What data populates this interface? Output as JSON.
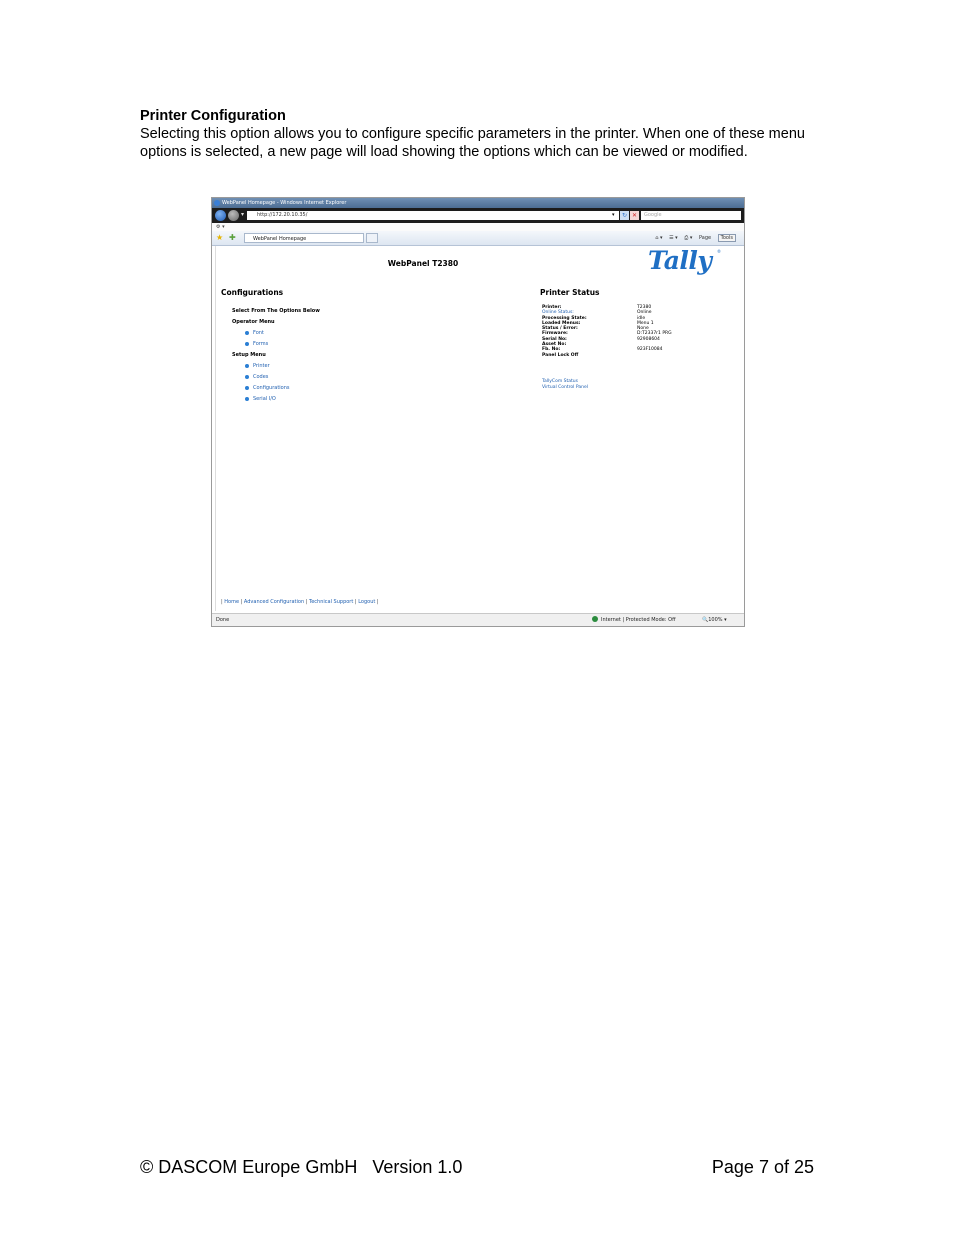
{
  "document": {
    "heading": "Printer Configuration",
    "body": "Selecting this option allows you to configure specific parameters in the printer.  When one of these menu options is selected, a new page will load showing the options which can be viewed or modified."
  },
  "browser": {
    "window_title": "WebPanel Homepage - Windows Internet Explorer",
    "url": "http://172.20.10.35/",
    "search_placeholder": "Google",
    "tab_label": "WebPanel Homepage",
    "tools": [
      "Page",
      "Tools"
    ],
    "status_left": "Done",
    "status_zone": "Internet | Protected Mode: Off",
    "status_zoom": "100%"
  },
  "webpanel": {
    "title": "WebPanel T2380",
    "logo": "Tally",
    "configurations_heading": "Configurations",
    "select_label": "Select From The Options Below",
    "operator_menu_label": "Operator Menu",
    "operator_items": [
      "Font",
      "Forms"
    ],
    "setup_menu_label": "Setup Menu",
    "setup_items": [
      "Printer",
      "Codes",
      "Configurations",
      "Serial I/O"
    ],
    "status_heading": "Printer Status",
    "status_rows": [
      {
        "key": "Printer:",
        "value": "T2380"
      },
      {
        "key": "Online Status:",
        "value": "Online",
        "link": true
      },
      {
        "key": "Processing State:",
        "value": "idle"
      },
      {
        "key": "Loaded Menus:",
        "value": "Menu 1"
      },
      {
        "key": "Status / Error:",
        "value": "None"
      },
      {
        "key": "Firmware:",
        "value": "D:T2337r1 PRG"
      },
      {
        "key": "Serial No:",
        "value": "92908604"
      },
      {
        "key": "Asset No:",
        "value": ""
      },
      {
        "key": "Fb. No:",
        "value": "923F10084"
      },
      {
        "key": "Panel Lock Off",
        "value": ""
      }
    ],
    "status_links": [
      "TallyCom Status",
      "Virtual Control Panel"
    ],
    "footer_links": [
      "Home",
      "Advanced Configuration",
      "Technical Support",
      "Logout"
    ]
  },
  "page_footer": {
    "left": "© DASCOM Europe GmbH   Version 1.0",
    "right": "Page 7 of 25"
  }
}
